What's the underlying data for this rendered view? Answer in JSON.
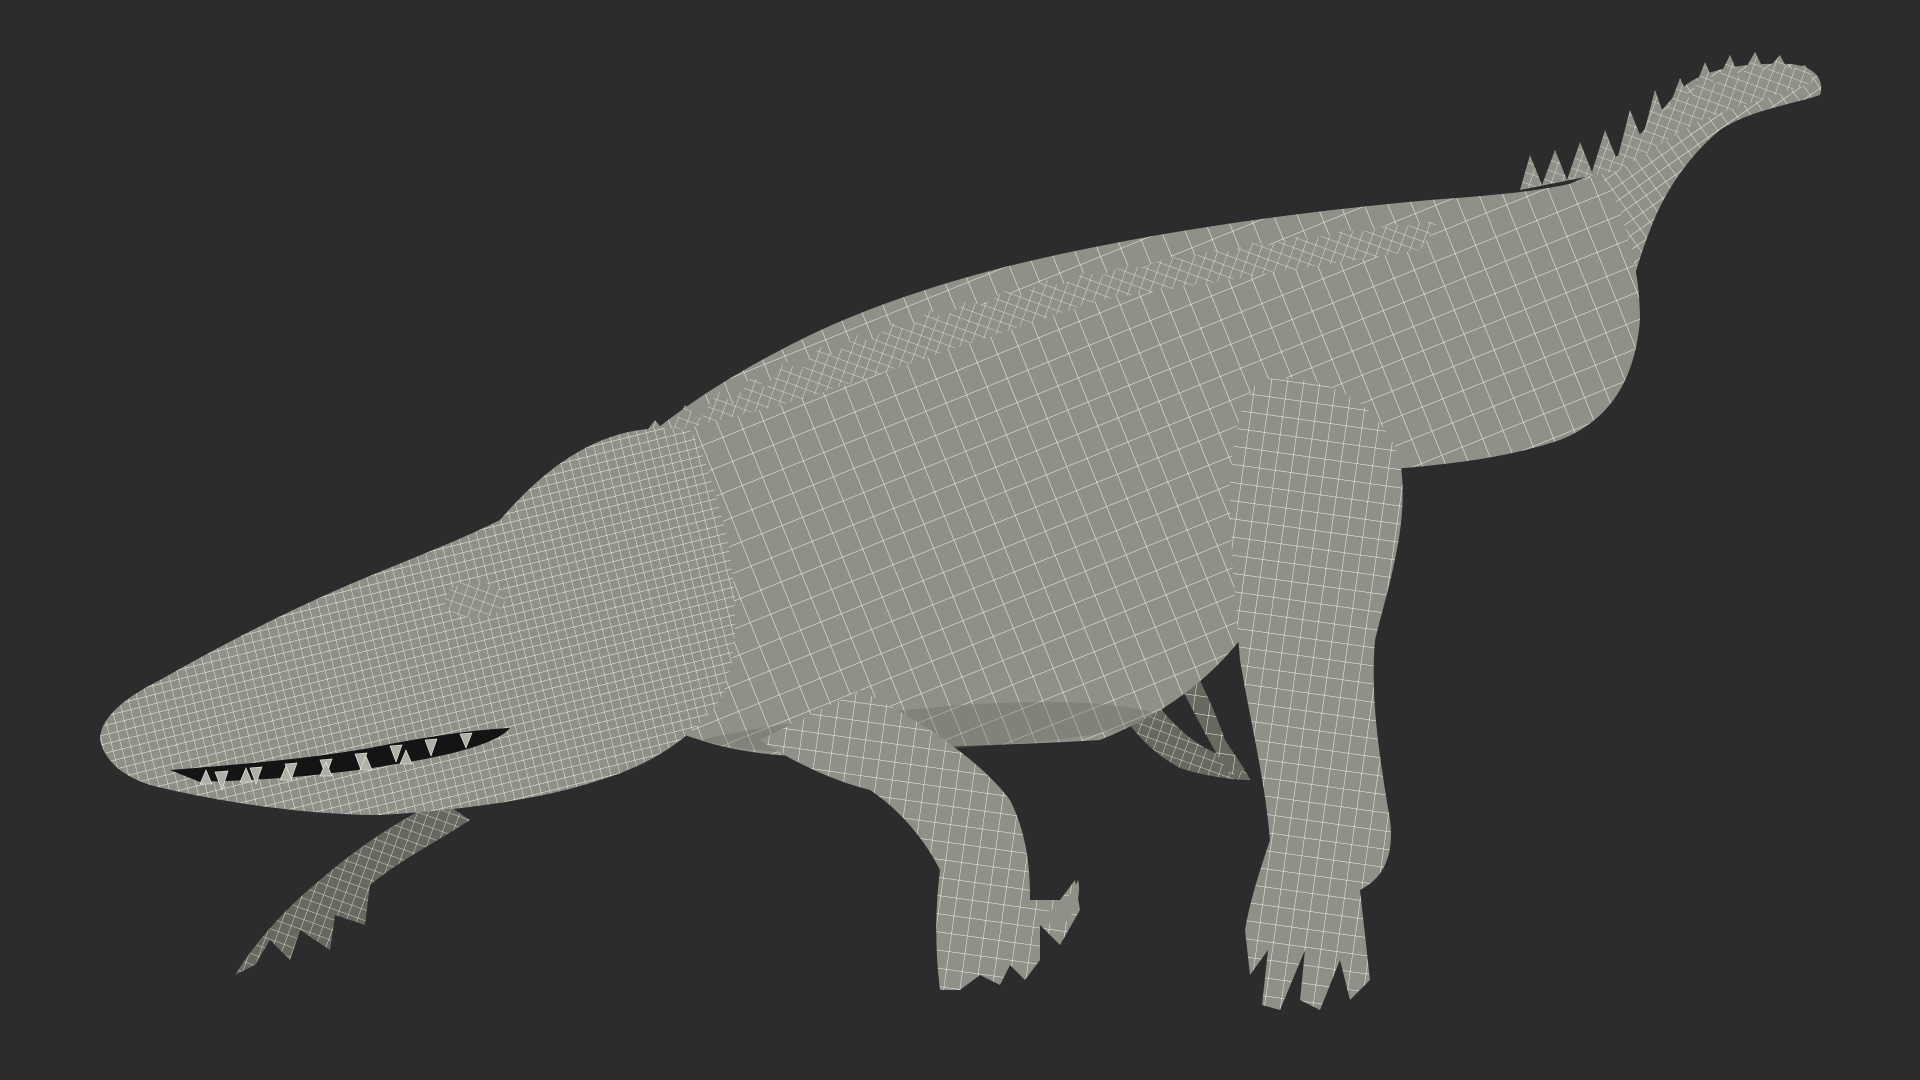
{
  "scene": {
    "background_color": "#2c2c2c",
    "surface_color": "#8e9188",
    "surface_shadow_color": "#666960",
    "surface_highlight_color": "#aeb1a7",
    "wire_color": "#f3f1e4",
    "mouth_interior_color": "#141414",
    "subject": "crocodile-wireframe-model"
  }
}
